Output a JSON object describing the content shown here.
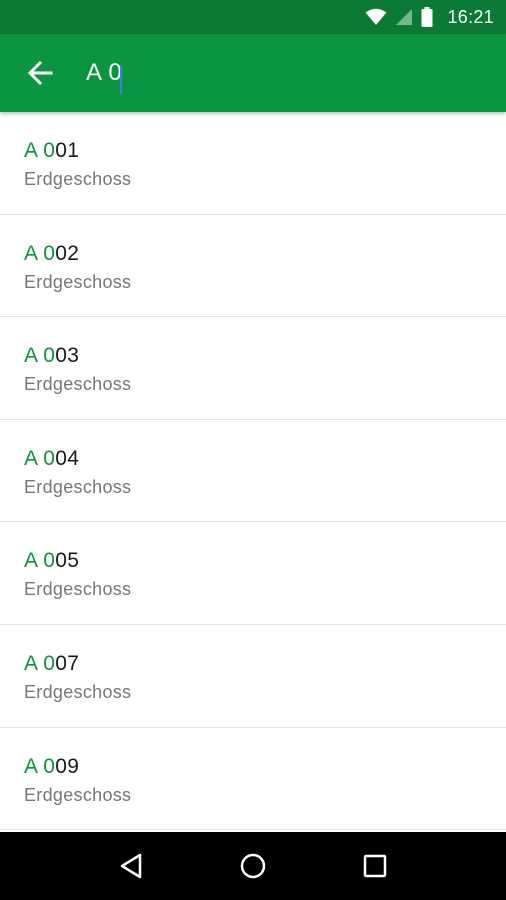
{
  "status_bar": {
    "time": "16:21",
    "icons": [
      "wifi-icon",
      "cellular-signal-icon",
      "battery-icon"
    ]
  },
  "app_bar": {
    "back_icon": "arrow-back-icon",
    "search_query": "A 0",
    "accent_color": "#0b9541"
  },
  "results": [
    {
      "match": "A 0",
      "rest": "01",
      "floor": "Erdgeschoss"
    },
    {
      "match": "A 0",
      "rest": "02",
      "floor": "Erdgeschoss"
    },
    {
      "match": "A 0",
      "rest": "03",
      "floor": "Erdgeschoss"
    },
    {
      "match": "A 0",
      "rest": "04",
      "floor": "Erdgeschoss"
    },
    {
      "match": "A 0",
      "rest": "05",
      "floor": "Erdgeschoss"
    },
    {
      "match": "A 0",
      "rest": "07",
      "floor": "Erdgeschoss"
    },
    {
      "match": "A 0",
      "rest": "09",
      "floor": "Erdgeschoss"
    }
  ],
  "nav_bar": {
    "buttons": [
      "back-triangle-icon",
      "home-circle-icon",
      "recents-square-icon"
    ]
  }
}
